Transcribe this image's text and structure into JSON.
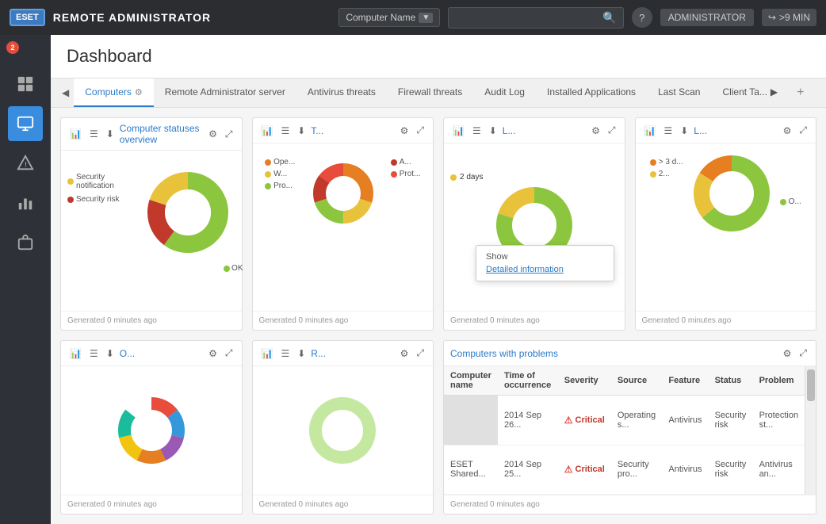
{
  "app": {
    "logo": "ESET",
    "title": "REMOTE ADMINISTRATOR",
    "admin_label": "ADMINISTRATOR",
    "logout_label": ">9 MIN",
    "search_placeholder": ""
  },
  "header": {
    "computer_name_label": "Computer Name",
    "search_icon": "🔍",
    "help_icon": "?",
    "session_time": ">9 MIN"
  },
  "sidebar": {
    "notification_count": "2",
    "items": [
      {
        "name": "dashboard",
        "icon": "⊙",
        "active": true
      },
      {
        "name": "computer",
        "icon": "🖥",
        "active": false
      },
      {
        "name": "warning",
        "icon": "⚠",
        "active": false
      },
      {
        "name": "chart",
        "icon": "📊",
        "active": false
      },
      {
        "name": "briefcase",
        "icon": "💼",
        "active": false
      }
    ]
  },
  "page_title": "Dashboard",
  "tabs": [
    {
      "label": "Computers",
      "active": true,
      "has_gear": true
    },
    {
      "label": "Remote Administrator server",
      "active": false
    },
    {
      "label": "Antivirus threats",
      "active": false
    },
    {
      "label": "Firewall threats",
      "active": false
    },
    {
      "label": "Audit Log",
      "active": false
    },
    {
      "label": "Installed Applications",
      "active": false
    },
    {
      "label": "Last Scan",
      "active": false
    },
    {
      "label": "Client Ta...",
      "active": false
    }
  ],
  "panels": [
    {
      "id": "computer-statuses",
      "title": "Computer statuses overview",
      "footer": "Generated 0 minutes ago",
      "legend": [
        {
          "label": "Security notification",
          "color": "#e8c23a"
        },
        {
          "label": "Security risk",
          "color": "#c0392b"
        },
        {
          "label": "OK",
          "color": "#8cc63f"
        }
      ],
      "donut": {
        "segments": [
          {
            "value": 60,
            "color": "#8cc63f"
          },
          {
            "value": 20,
            "color": "#c0392b"
          },
          {
            "value": 20,
            "color": "#e8c23a"
          }
        ]
      }
    },
    {
      "id": "panel-t",
      "title": "T...",
      "footer": "Generated 0 minutes ago",
      "legend": [
        {
          "label": "Ope...",
          "color": "#e67e22"
        },
        {
          "label": "W...",
          "color": "#e8c23a"
        },
        {
          "label": "Pro...",
          "color": "#8cc63f"
        },
        {
          "label": "A...",
          "color": "#c0392b"
        },
        {
          "label": "Prot...",
          "color": "#e74c3c"
        }
      ],
      "donut": {
        "segments": [
          {
            "value": 30,
            "color": "#e67e22"
          },
          {
            "value": 20,
            "color": "#e8c23a"
          },
          {
            "value": 20,
            "color": "#8cc63f"
          },
          {
            "value": 15,
            "color": "#c0392b"
          },
          {
            "value": 15,
            "color": "#e74c3c"
          }
        ]
      }
    },
    {
      "id": "panel-l1",
      "title": "L...",
      "footer": "Generated 0 minutes ago",
      "legend": [
        {
          "label": "2 days",
          "color": "#e8c23a"
        }
      ],
      "donut": {
        "segments": [
          {
            "value": 80,
            "color": "#8cc63f"
          },
          {
            "value": 20,
            "color": "#e8c23a"
          }
        ]
      },
      "show_label": "Show",
      "popup": true
    },
    {
      "id": "panel-l2",
      "title": "L...",
      "footer": "Generated 0 minutes ago",
      "legend": [
        {
          "label": "> 3 d...",
          "color": "#e67e22"
        },
        {
          "label": "2...",
          "color": "#e8c23a"
        },
        {
          "label": "O...",
          "color": "#8cc63f"
        }
      ],
      "donut": {
        "segments": [
          {
            "value": 65,
            "color": "#8cc63f"
          },
          {
            "value": 20,
            "color": "#e8c23a"
          },
          {
            "value": 15,
            "color": "#e67e22"
          }
        ]
      }
    }
  ],
  "bottom_panels": [
    {
      "id": "panel-o",
      "title": "O...",
      "footer": "Generated 0 minutes ago",
      "donut": {
        "segments": [
          {
            "value": 15,
            "color": "#e74c3c"
          },
          {
            "value": 15,
            "color": "#3498db"
          },
          {
            "value": 15,
            "color": "#9b59b6"
          },
          {
            "value": 15,
            "color": "#e67e22"
          },
          {
            "value": 15,
            "color": "#f1c40f"
          },
          {
            "value": 15,
            "color": "#1abc9c"
          },
          {
            "value": 10,
            "color": "#e8c23a"
          }
        ]
      }
    },
    {
      "id": "panel-r",
      "title": "R...",
      "footer": "Generated 0 minutes ago",
      "donut": {
        "segments": [
          {
            "value": 100,
            "color": "#c5e8a0"
          }
        ]
      }
    }
  ],
  "problems_panel": {
    "title": "Computers with problems",
    "footer": "Generated 0 minutes ago",
    "columns": [
      "Computer name",
      "Time of occurrence",
      "Severity",
      "Source",
      "Feature",
      "Status",
      "Problem"
    ],
    "rows": [
      {
        "computer_name": "",
        "time": "2014 Sep 26...",
        "severity": "Critical",
        "source": "Operating s...",
        "feature": "Antivirus",
        "status": "Security risk",
        "problem": "Protection st..."
      },
      {
        "computer_name": "ESET Shared...",
        "time": "2014 Sep 25...",
        "severity": "Critical",
        "source": "Security pro...",
        "feature": "Antivirus",
        "status": "Security risk",
        "problem": "Antivirus an..."
      }
    ]
  },
  "popup": {
    "show_label": "Show",
    "detailed_link": "Detailed information"
  }
}
